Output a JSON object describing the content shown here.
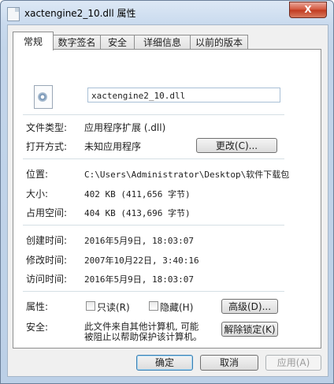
{
  "window": {
    "title": "xactengine2_10.dll 属性",
    "close_glyph": "X"
  },
  "tabs": [
    {
      "label": "常规",
      "active": true
    },
    {
      "label": "数字签名"
    },
    {
      "label": "安全"
    },
    {
      "label": "详细信息"
    },
    {
      "label": "以前的版本"
    }
  ],
  "general": {
    "file_name": "xactengine2_10.dll",
    "file_type_label": "文件类型:",
    "file_type_value": "应用程序扩展 (.dll)",
    "open_with_label": "打开方式:",
    "open_with_value": "未知应用程序",
    "change_button": "更改(C)...",
    "location_label": "位置:",
    "location_value": "C:\\Users\\Administrator\\Desktop\\软件下载包",
    "size_label": "大小:",
    "size_value": "402 KB (411,656 字节)",
    "size_on_disk_label": "占用空间:",
    "size_on_disk_value": "404 KB (413,696 字节)",
    "created_label": "创建时间:",
    "created_value": "2016年5月9日, 18:03:07",
    "modified_label": "修改时间:",
    "modified_value": "2007年10月22日, 3:40:16",
    "accessed_label": "访问时间:",
    "accessed_value": "2016年5月9日, 18:03:07",
    "attributes_label": "属性:",
    "readonly_label": "只读(R)",
    "hidden_label": "隐藏(H)",
    "advanced_button": "高级(D)...",
    "security_label": "安全:",
    "security_text_line1": "此文件来自其他计算机, 可能",
    "security_text_line2": "被阻止以帮助保护该计算机。",
    "unblock_button": "解除锁定(K)"
  },
  "footer": {
    "ok": "确定",
    "cancel": "取消",
    "apply": "应用(A)"
  }
}
